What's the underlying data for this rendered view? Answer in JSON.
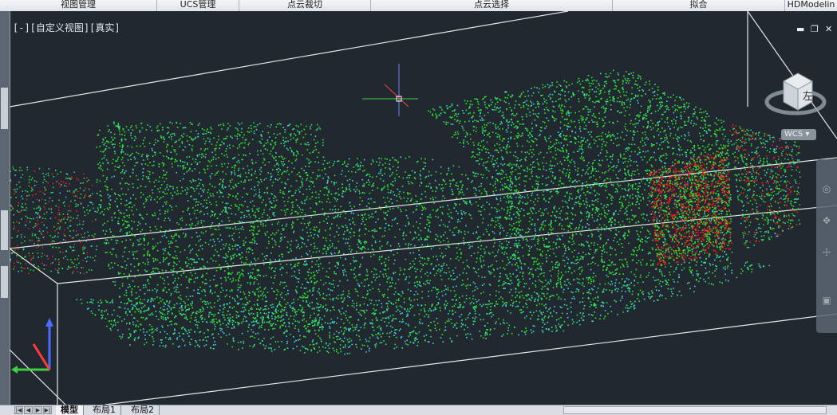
{
  "ribbon": {
    "tabs": [
      "视图管理",
      "UCS管理",
      "点云裁切",
      "点云选择",
      "拟合",
      "HDModelin"
    ]
  },
  "viewport": {
    "label": "[-][自定义视图][真实]",
    "minimize": "▬",
    "restore": "❐",
    "close": "✕"
  },
  "viewcube": {
    "face": "左"
  },
  "wcs": {
    "label": "WCS ▾"
  },
  "navbar": {
    "icons": [
      "◎",
      "✥",
      "☩",
      "▣"
    ]
  },
  "layout_tabs": [
    "模型",
    "布局1",
    "布局2"
  ],
  "colors": {
    "background": "#212830",
    "cloud_green": "#2ee82e",
    "cloud_cyan": "#3ddddd",
    "cloud_red": "#ff1c1c",
    "box_lines": "#e6e6e6"
  }
}
